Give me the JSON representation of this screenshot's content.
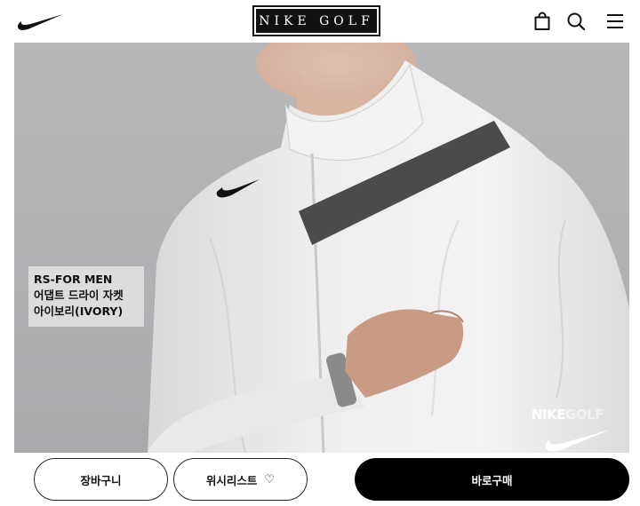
{
  "header": {
    "brand": "NIKE GOLF",
    "icons": [
      "shopping-bag-icon",
      "search-icon",
      "menu-icon"
    ]
  },
  "hero": {
    "caption": {
      "line1": "RS-FOR MEN",
      "line2": "어댑트 드라이 자켓",
      "line3": "아이보리(IVORY)"
    },
    "watermark": {
      "bold": "NIKE",
      "light": "GOLF"
    }
  },
  "actions": {
    "cart_label": "장바구니",
    "wishlist_label": "위시리스트",
    "wishlist_icon": "heart-icon",
    "buy_label": "바로구매"
  },
  "colors": {
    "primary": "#000000",
    "background": "#ffffff",
    "hero_bg": "#b3b2b5"
  }
}
